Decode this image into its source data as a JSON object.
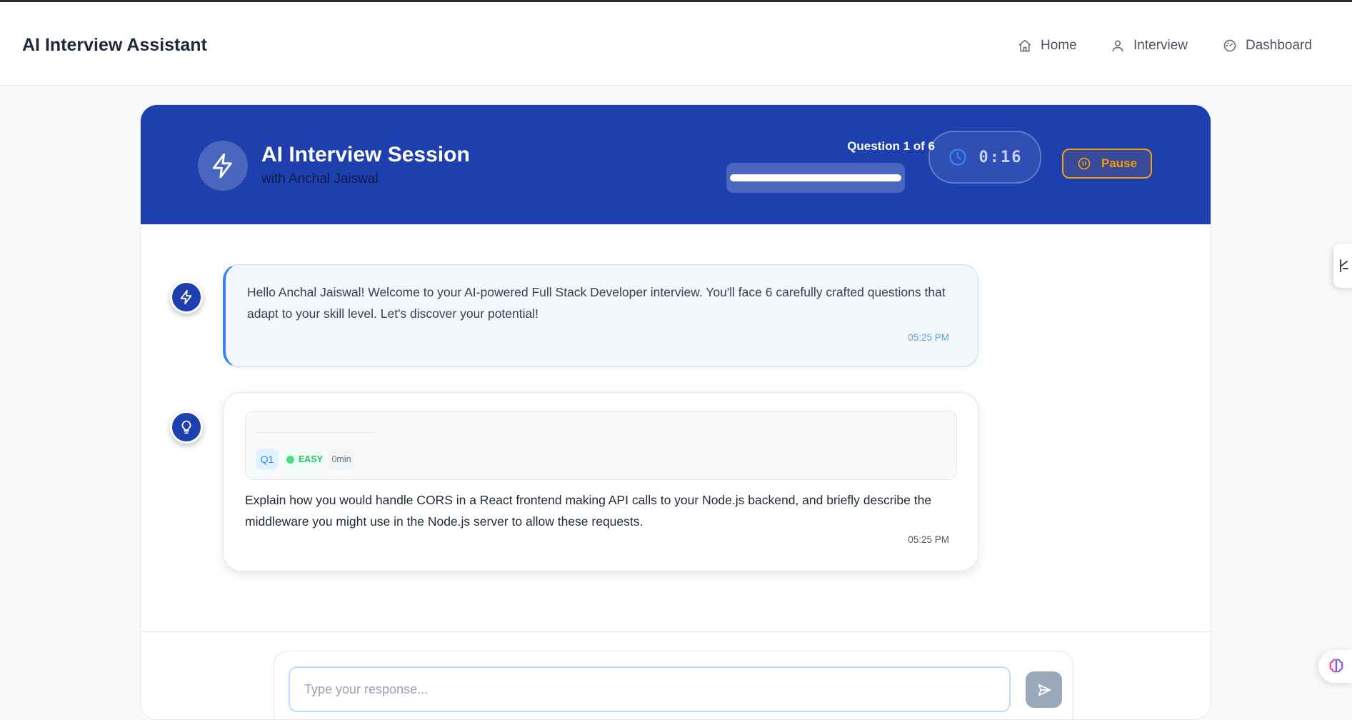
{
  "app": {
    "brand": "AI Interview Assistant"
  },
  "nav": {
    "items": [
      {
        "label": "Home",
        "icon": "home-icon"
      },
      {
        "label": "Interview",
        "icon": "user-icon"
      },
      {
        "label": "Dashboard",
        "icon": "gauge-icon"
      }
    ]
  },
  "session": {
    "title": "AI Interview Session",
    "subtitle": "with Anchal Jaiswal",
    "question_label": "Question 1 of 6",
    "timer": "0:16",
    "pause_label": "Pause"
  },
  "messages": [
    {
      "text": "Hello Anchal Jaiswal! Welcome to your AI-powered Full Stack Developer interview. You'll face 6 carefully crafted questions that adapt to your skill level. Let's discover your potential!",
      "time": "05:25 PM",
      "avatar_icon": "lightning-icon"
    },
    {
      "question_tag": "Q1",
      "difficulty": "EASY",
      "duration": "0min",
      "text": "Explain how you would handle CORS in a React frontend making API calls to your Node.js backend, and briefly describe the middleware you might use in the Node.js server to allow these requests.",
      "time": "05:25 PM",
      "avatar_icon": "lightbulb-icon"
    }
  ],
  "composer": {
    "placeholder": "Type your response..."
  },
  "colors": {
    "primary": "#1e40af",
    "accent": "#f59e0b",
    "easy": "#22c55e"
  }
}
